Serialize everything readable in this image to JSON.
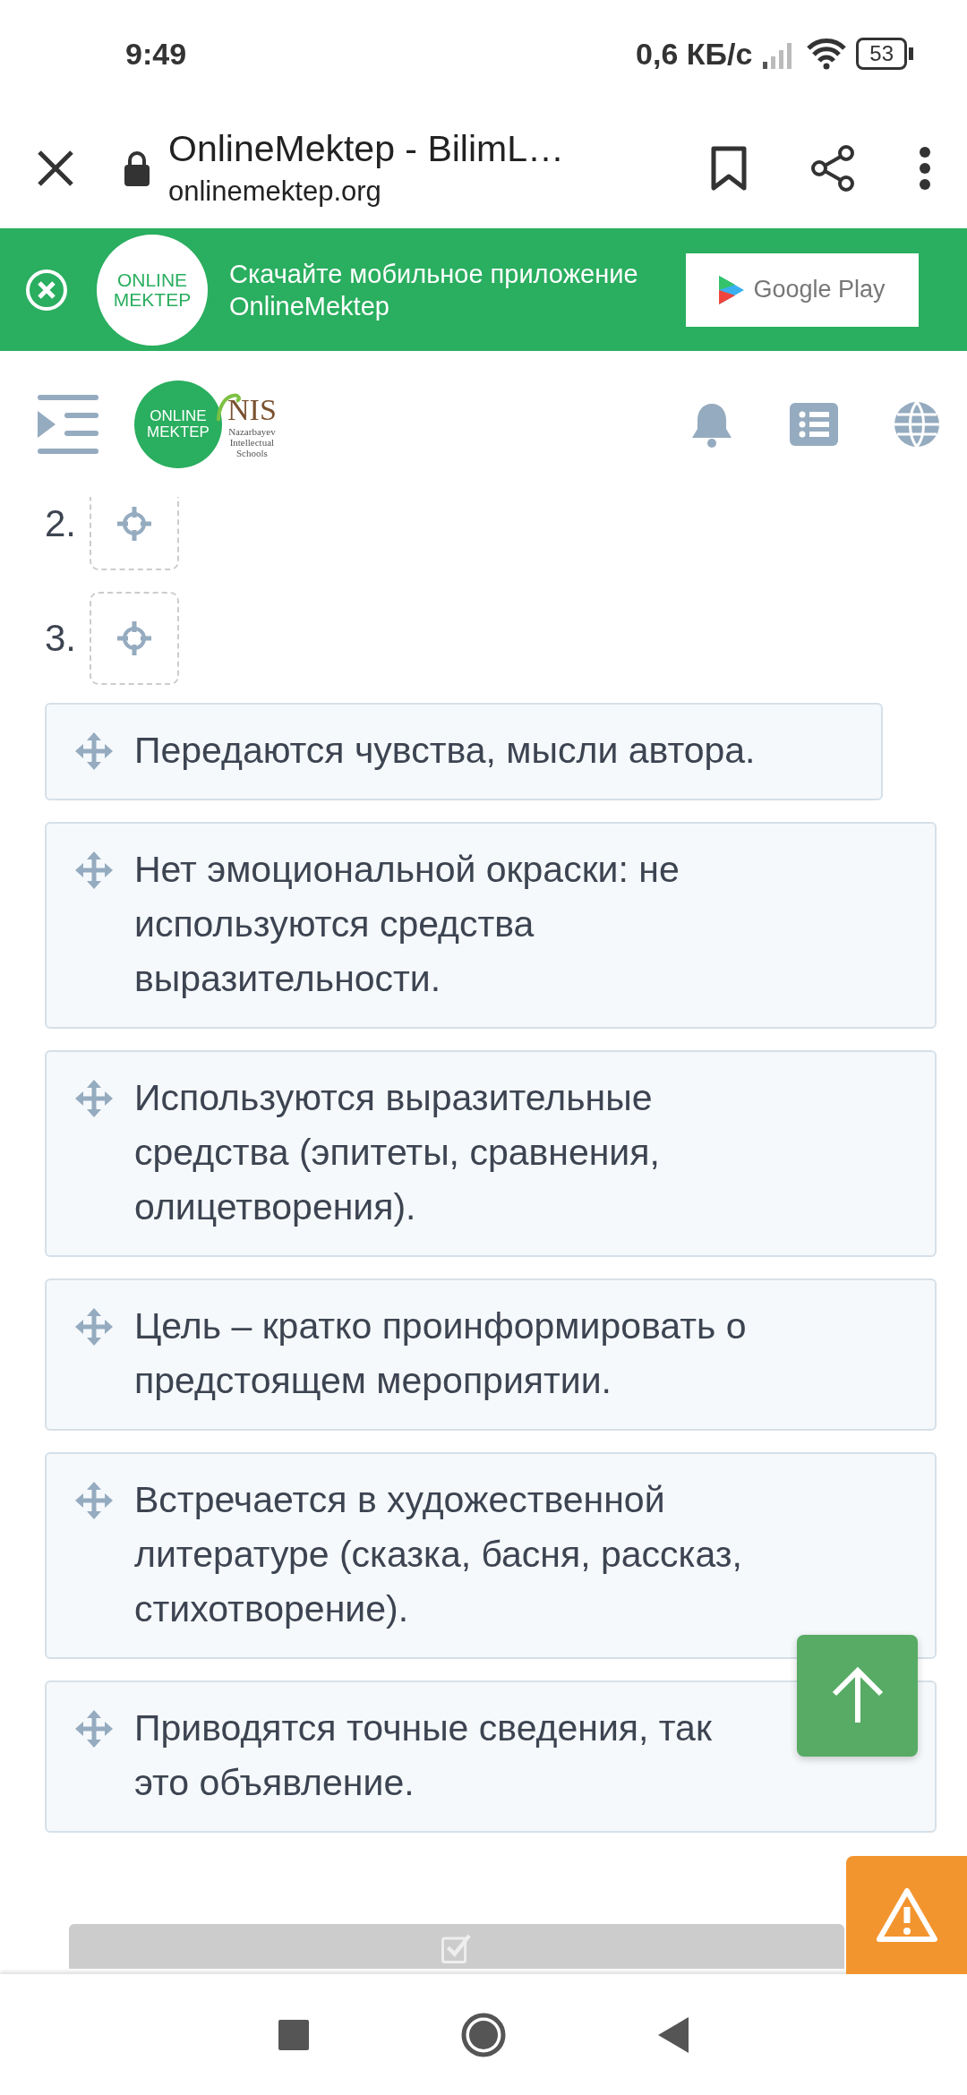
{
  "status_bar": {
    "time": "9:49",
    "network_speed": "0,6 КБ/с",
    "battery": "53"
  },
  "browser": {
    "title": "OnlineMektep - BilimL…",
    "url": "onlinemektep.org"
  },
  "app_banner": {
    "logo_lines": [
      "ONLINE",
      "MEKTEP"
    ],
    "text": "Скачайте мобильное приложение OnlineMektep",
    "store_badge": "Google Play"
  },
  "site_header": {
    "logo_lines": [
      "ONLINE",
      "MEKTEP"
    ],
    "partner_name": "NIS",
    "partner_lines": [
      "Nazarbayev",
      "Intellectual",
      "Schools"
    ]
  },
  "drop_slots": [
    {
      "number": "2."
    },
    {
      "number": "3."
    }
  ],
  "cards": [
    {
      "lines": [
        "Передаются чувства, мысли автора."
      ]
    },
    {
      "lines": [
        "Нет эмоциональной окраски: не",
        "используются средства",
        "выразительности."
      ]
    },
    {
      "lines": [
        "Используются выразительные",
        "средства (эпитеты, сравнения,",
        "олицетворения)."
      ]
    },
    {
      "lines": [
        "Цель – кратко проинформировать о",
        "предстоящем мероприятии."
      ]
    },
    {
      "lines": [
        "Встречается в художественной",
        "литературе (сказка, басня, рассказ,",
        "стихотворение)."
      ]
    },
    {
      "lines": [
        "Приводятся точные сведения, так",
        "это объявление."
      ]
    }
  ],
  "check_button": {
    "disabled": true
  }
}
